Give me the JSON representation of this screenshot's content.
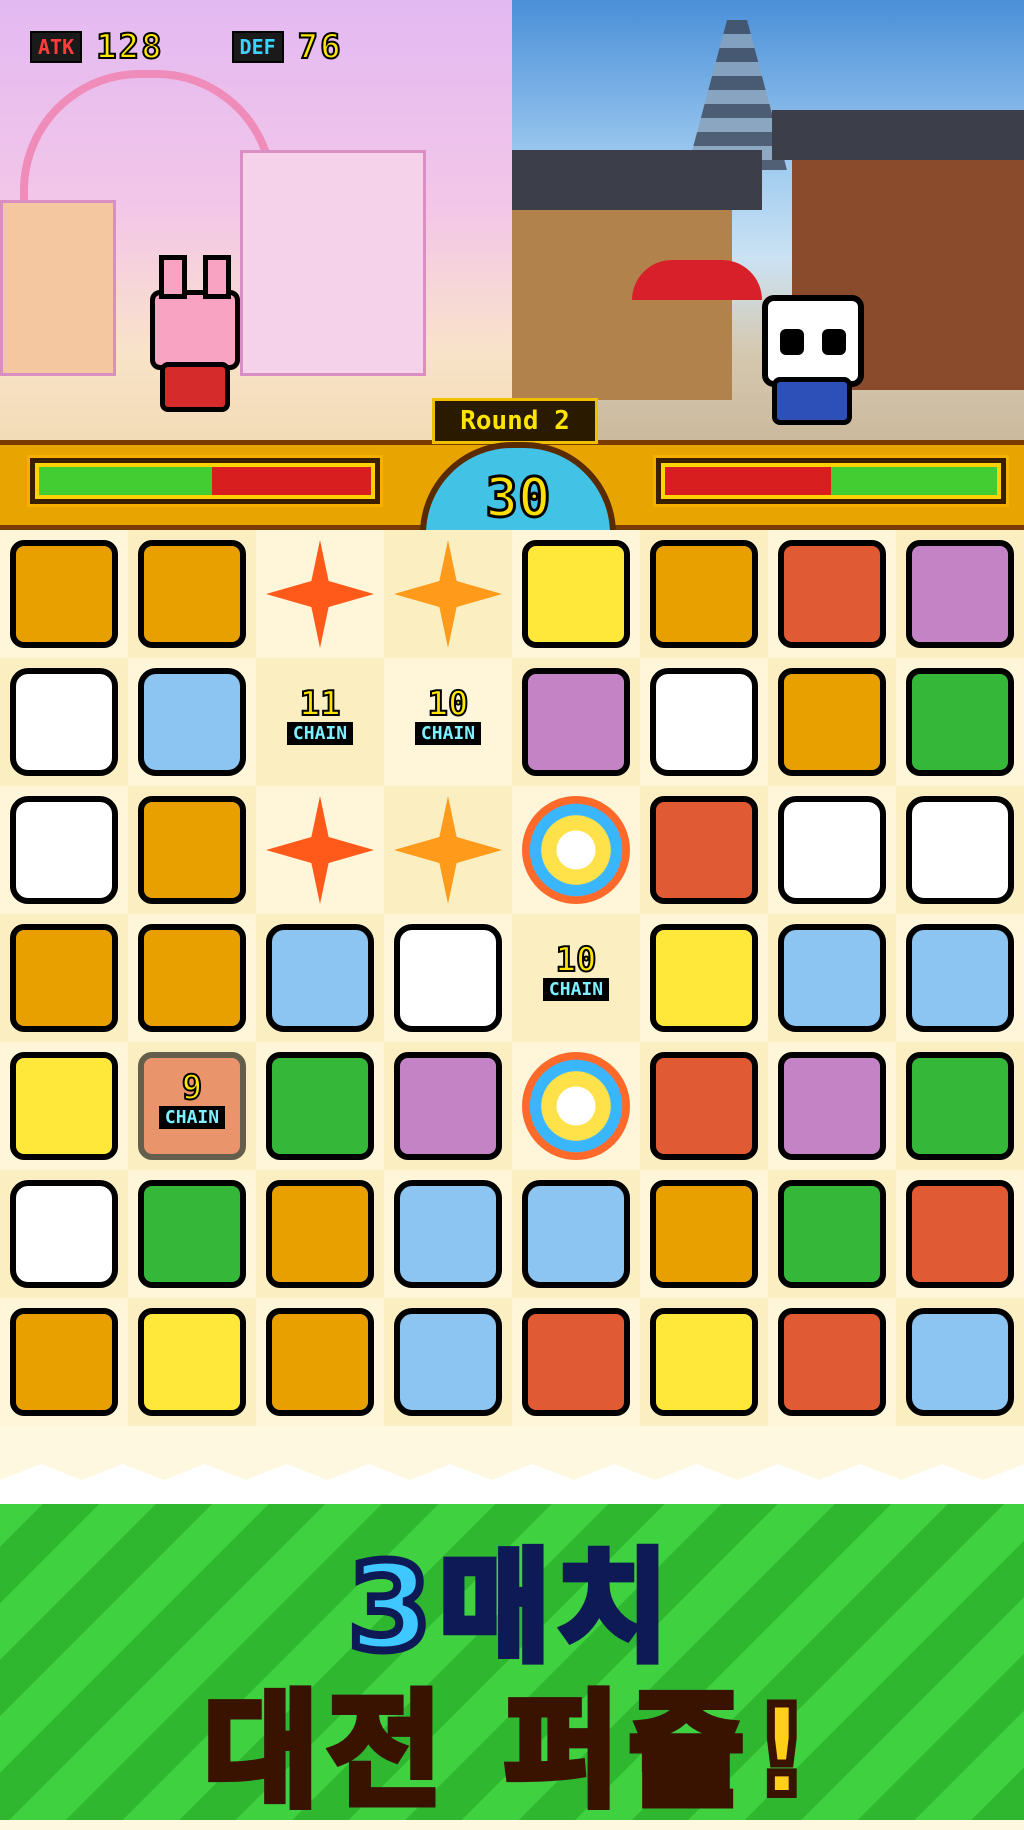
{
  "player": {
    "atk_label": "ATK",
    "atk_value": "128",
    "def_label": "DEF",
    "def_value": "76",
    "hp_fraction": 0.52
  },
  "enemy": {
    "hp_fraction": 0.5
  },
  "round_label": "Round 2",
  "timer": "30",
  "colors": {
    "hp_green": "#44cc33",
    "hp_red": "#d81e1e",
    "banner_green": "#3fd13f"
  },
  "board": {
    "tile_types": {
      "lion": {
        "color": "#e8a000",
        "icon": "lion-tile-icon"
      },
      "giraffe": {
        "color": "#ffe83a",
        "icon": "giraffe-tile-icon"
      },
      "monkey": {
        "color": "#e05a33",
        "icon": "monkey-tile-icon"
      },
      "hippo": {
        "color": "#c483c4",
        "icon": "hippo-tile-icon"
      },
      "panda": {
        "color": "#ffffff",
        "icon": "panda-tile-icon"
      },
      "elephant": {
        "color": "#8cc4f2",
        "icon": "elephant-tile-icon"
      },
      "frog": {
        "color": "#35b83a",
        "icon": "frog-tile-icon"
      },
      "burst": {
        "color": "#ff5a1a",
        "icon": "burst-icon"
      },
      "star": {
        "color": "#ff9a1a",
        "icon": "star-burst-icon"
      },
      "ring": {
        "color": "#ffd24a",
        "icon": "ring-burst-icon"
      }
    },
    "grid": [
      [
        "lion",
        "lion",
        "burst",
        "star",
        "giraffe",
        "lion",
        "monkey",
        "hippo"
      ],
      [
        "panda",
        "elephant",
        "chain",
        "chain",
        "hippo",
        "panda",
        "lion",
        "frog"
      ],
      [
        "panda",
        "lion",
        "burst",
        "star",
        "ring",
        "monkey",
        "panda",
        "panda"
      ],
      [
        "lion",
        "lion",
        "elephant",
        "panda",
        "chain",
        "giraffe",
        "elephant",
        "elephant"
      ],
      [
        "giraffe",
        "monkey",
        "frog",
        "hippo",
        "ring",
        "monkey",
        "hippo",
        "frog"
      ],
      [
        "panda",
        "frog",
        "lion",
        "elephant",
        "elephant",
        "lion",
        "frog",
        "monkey"
      ],
      [
        "lion",
        "giraffe",
        "lion",
        "elephant",
        "monkey",
        "giraffe",
        "monkey",
        "elephant"
      ]
    ],
    "chains": [
      {
        "row": 1,
        "col": 2,
        "count": "11",
        "label": "CHAIN"
      },
      {
        "row": 1,
        "col": 3,
        "count": "10",
        "label": "CHAIN"
      },
      {
        "row": 3,
        "col": 4,
        "count": "10",
        "label": "CHAIN"
      },
      {
        "row": 4,
        "col": 1,
        "count": "9",
        "label": "CHAIN"
      }
    ]
  },
  "banner": {
    "line1": "3매치",
    "line2": "대전 퍼즐!"
  }
}
